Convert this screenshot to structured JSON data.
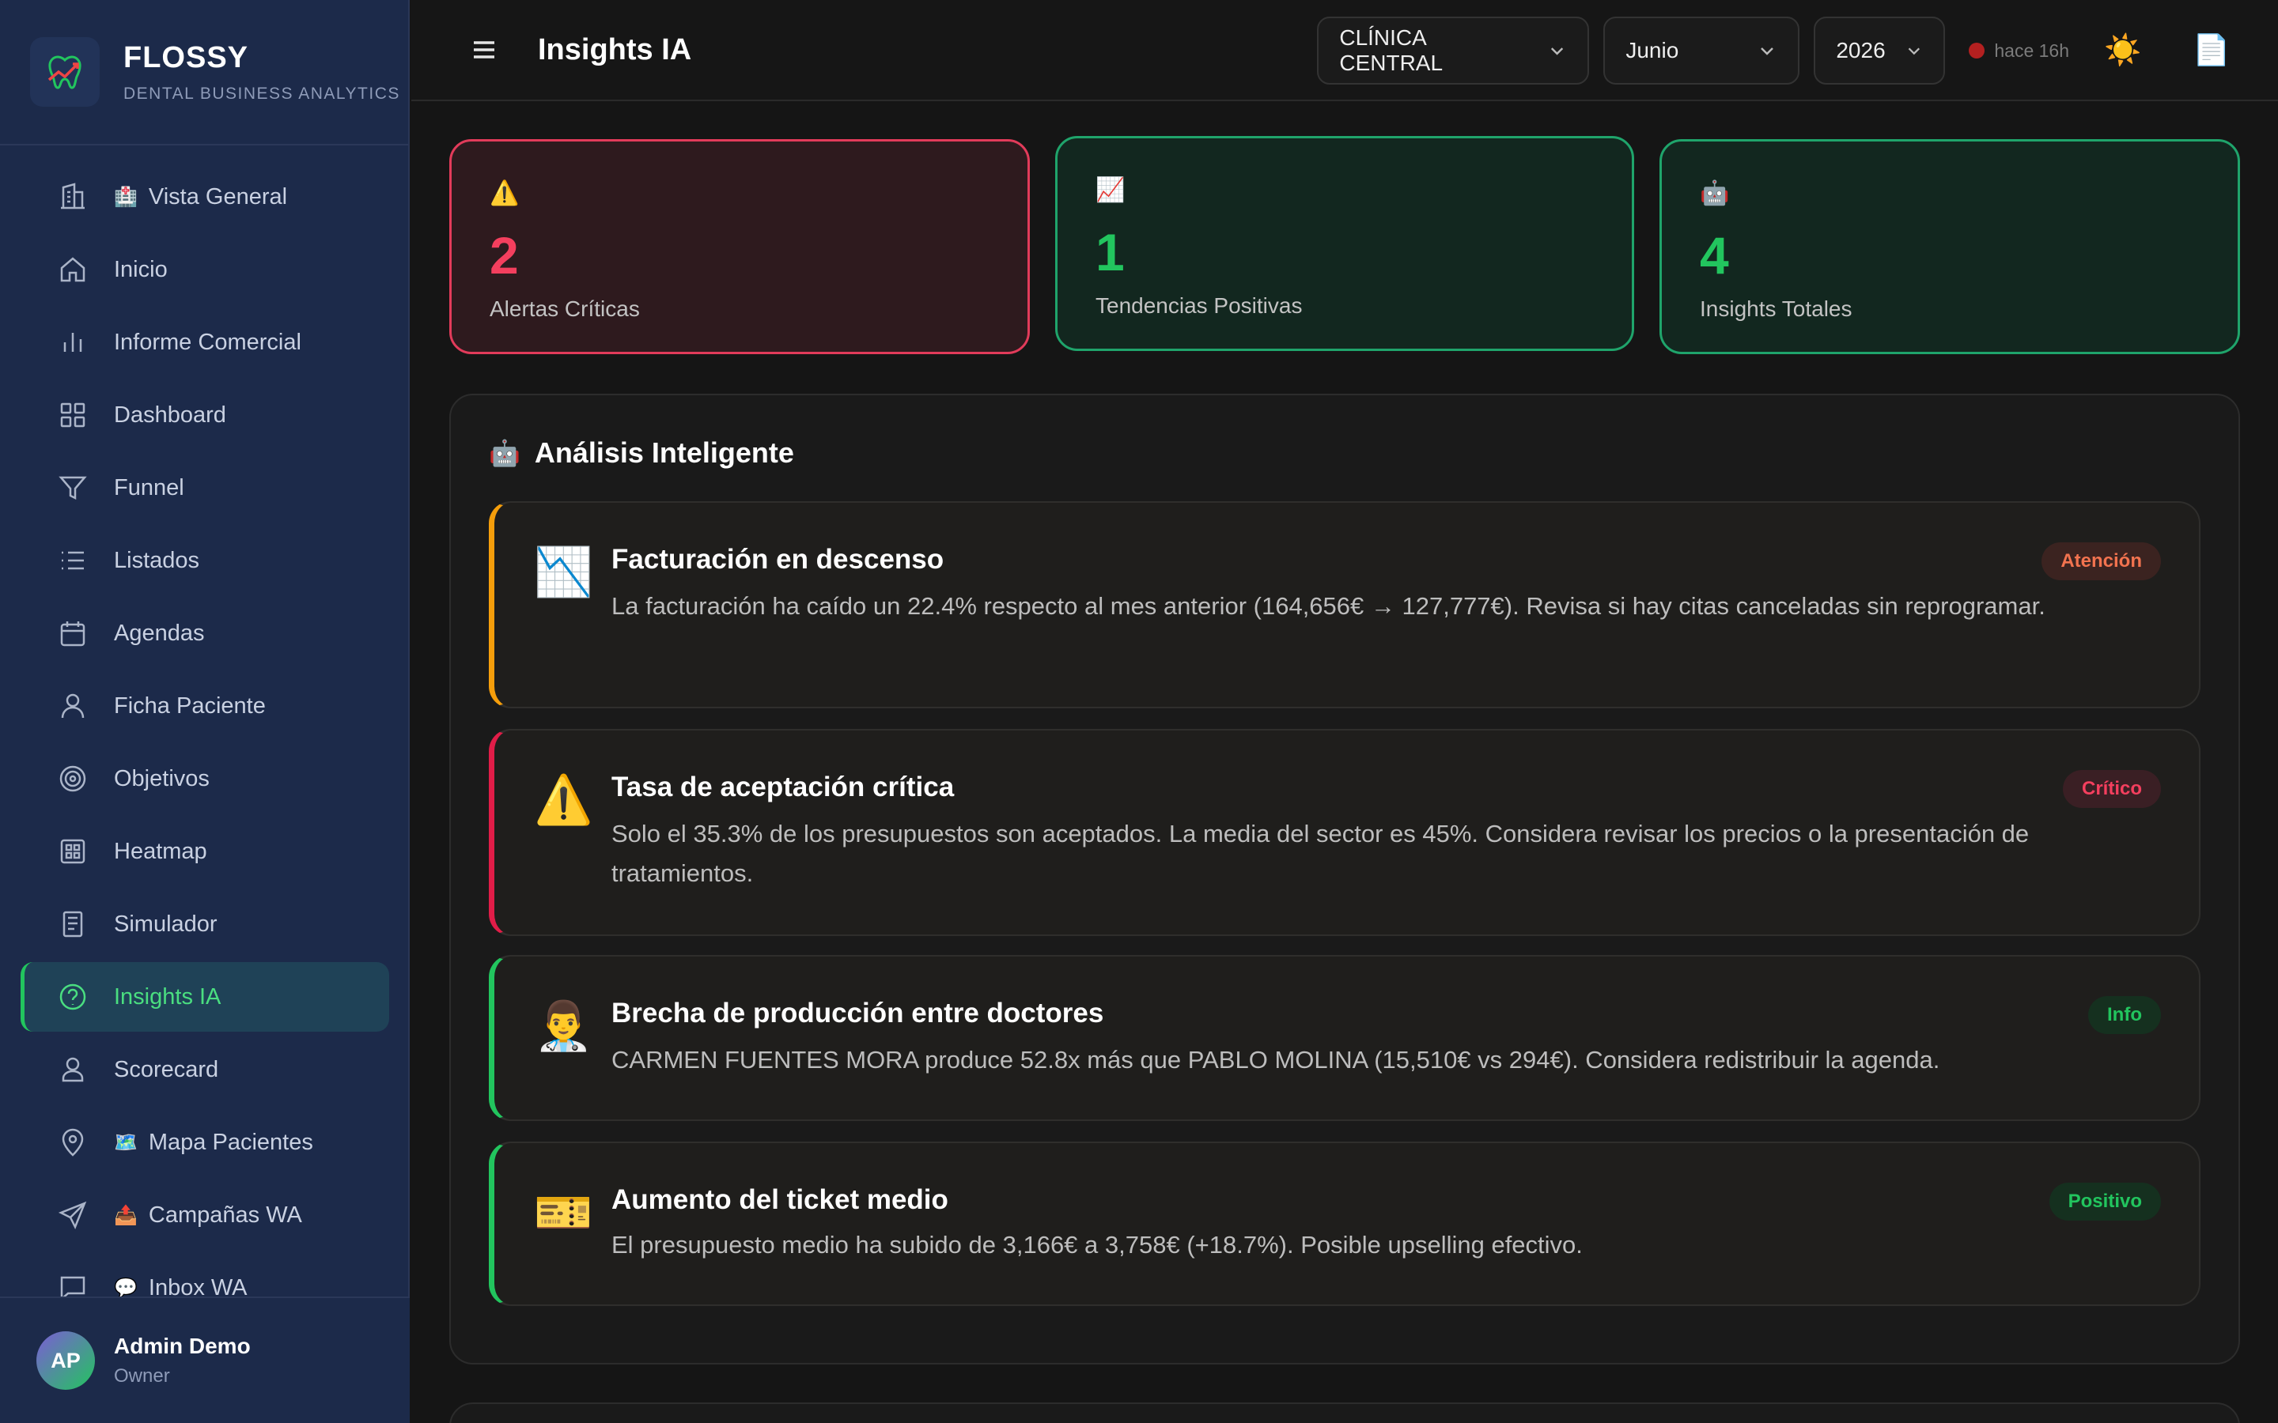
{
  "brand": {
    "name": "FLOSSY",
    "subtitle": "DENTAL BUSINESS ANALYTICS"
  },
  "sidebar": {
    "items": [
      {
        "label": "Vista General",
        "icon": "building-icon",
        "emoji": "🏥"
      },
      {
        "label": "Inicio",
        "icon": "home-icon"
      },
      {
        "label": "Informe Comercial",
        "icon": "bar-chart-icon"
      },
      {
        "label": "Dashboard",
        "icon": "grid-icon"
      },
      {
        "label": "Funnel",
        "icon": "filter-icon"
      },
      {
        "label": "Listados",
        "icon": "list-icon"
      },
      {
        "label": "Agendas",
        "icon": "calendar-icon"
      },
      {
        "label": "Ficha Paciente",
        "icon": "user-icon"
      },
      {
        "label": "Objetivos",
        "icon": "target-icon"
      },
      {
        "label": "Heatmap",
        "icon": "heatmap-icon"
      },
      {
        "label": "Simulador",
        "icon": "calculator-icon"
      },
      {
        "label": "Insights IA",
        "icon": "help-circle-icon",
        "active": true
      },
      {
        "label": "Scorecard",
        "icon": "user-card-icon"
      },
      {
        "label": "Mapa Pacientes",
        "icon": "map-pin-icon",
        "emoji": "🗺️"
      },
      {
        "label": "Campañas WA",
        "icon": "send-icon",
        "emoji": "📤"
      },
      {
        "label": "Inbox WA",
        "icon": "message-icon",
        "emoji": "💬"
      }
    ]
  },
  "user": {
    "initials": "AP",
    "name": "Admin Demo",
    "role": "Owner"
  },
  "header": {
    "title": "Insights IA",
    "clinic": "CLÍNICA CENTRAL",
    "month": "Junio",
    "year": "2026",
    "status": "hace 16h",
    "theme_icon": "☀️",
    "export_icon": "📄"
  },
  "stats": [
    {
      "icon": "⚠️",
      "value": "2",
      "label": "Alertas Críticas"
    },
    {
      "icon": "📈",
      "value": "1",
      "label": "Tendencias Positivas"
    },
    {
      "icon": "🤖",
      "value": "4",
      "label": "Insights Totales"
    }
  ],
  "analysis": {
    "title": "Análisis Inteligente",
    "emoji": "🤖",
    "insights": [
      {
        "emoji": "📉",
        "title": "Facturación en descenso",
        "text": "La facturación ha caído un 22.4% respecto al mes anterior (164,656€ → 127,777€). Revisa si hay citas canceladas sin reprogramar.",
        "badge": "Atención",
        "accent": "#f59e0b",
        "badge_bg": "#3b2320",
        "badge_color": "#f2734f"
      },
      {
        "emoji": "⚠️",
        "title": "Tasa de aceptación crítica",
        "text": "Solo el 35.3% de los presupuestos son aceptados. La media del sector es 45%. Considera revisar los precios o la presentación de tratamientos.",
        "badge": "Crítico",
        "accent": "#e11d48",
        "badge_bg": "#3a1f24",
        "badge_color": "#f43f5e"
      },
      {
        "emoji": "👨‍⚕️",
        "title": "Brecha de producción entre doctores",
        "text": "CARMEN FUENTES MORA produce 52.8x más que PABLO MOLINA (15,510€ vs 294€). Considera redistribuir la agenda.",
        "badge": "Info",
        "accent": "#22c55e",
        "badge_bg": "#15301f",
        "badge_color": "#22c55e"
      },
      {
        "emoji": "🎫",
        "title": "Aumento del ticket medio",
        "text": "El presupuesto medio ha subido de 3,166€ a 3,758€ (+18.7%). Posible upselling efectivo.",
        "badge": "Positivo",
        "accent": "#22c55e",
        "badge_bg": "#15301f",
        "badge_color": "#22c55e"
      }
    ]
  }
}
